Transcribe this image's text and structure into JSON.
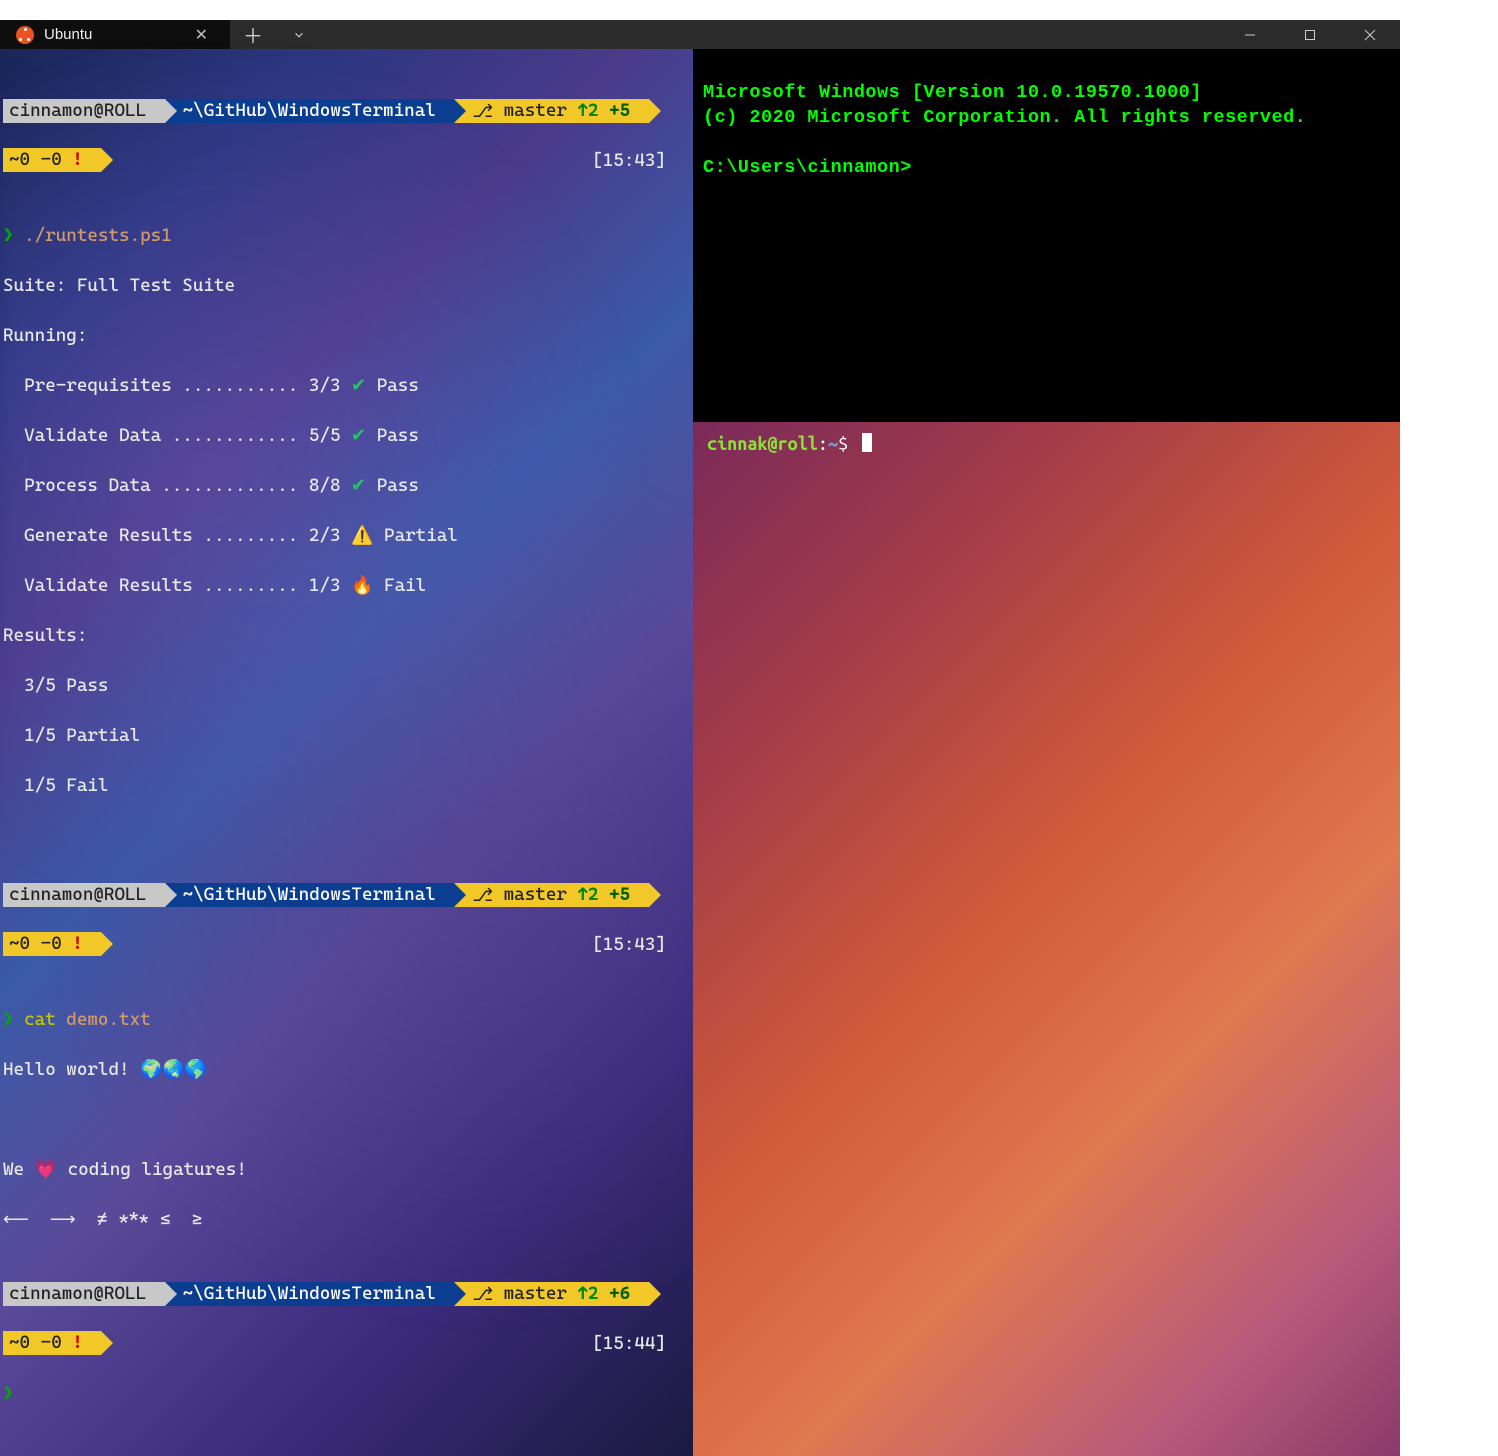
{
  "titlebar": {
    "tab_name": "Ubuntu",
    "close_symbol": "✕",
    "add_symbol": "＋"
  },
  "left": {
    "prompt1": {
      "host": "cinnamon@ROLL ",
      "path": "~\\GitHub\\WindowsTerminal ",
      "branch_icon": "⎇",
      "branch": " master ",
      "ahead": "↑2 ",
      "staged": "+5 ",
      "status": "~0 -0 ",
      "bang": "!",
      "time": "[15:43]"
    },
    "cmd1_caret": "❯ ",
    "cmd1": "./runtests.ps1",
    "suite_label": "Suite: Full Test Suite",
    "running_label": "Running:",
    "tests": [
      {
        "name": "  Pre-requisites ........... 3/3 ",
        "icon": "✔",
        "status": " Pass"
      },
      {
        "name": "  Validate Data ............ 5/5 ",
        "icon": "✔",
        "status": " Pass"
      },
      {
        "name": "  Process Data ............. 8/8 ",
        "icon": "✔",
        "status": " Pass"
      },
      {
        "name": "  Generate Results ......... 2/3 ",
        "icon": "⚠️",
        "status": " Partial"
      },
      {
        "name": "  Validate Results ......... 1/3 ",
        "icon": "🔥",
        "status": " Fail"
      }
    ],
    "results_label": "Results:",
    "results": [
      "  3/5 Pass",
      "  1/5 Partial",
      "  1/5 Fail"
    ],
    "prompt2": {
      "host": "cinnamon@ROLL ",
      "path": "~\\GitHub\\WindowsTerminal ",
      "branch_icon": "⎇",
      "branch": " master ",
      "ahead": "↑2 ",
      "staged": "+5 ",
      "status": "~0 -0 ",
      "bang": "!",
      "time": "[15:43]"
    },
    "cmd2_caret": "❯ ",
    "cmd2_cmd": "cat ",
    "cmd2_arg": "demo.txt",
    "hello": "Hello world! 🌍🌏🌎",
    "ligatures_line": "We 💗 coding ligatures!",
    "symbols_line": "⟵  ⟶  ≠ *** ≤  ≥",
    "prompt3": {
      "host": "cinnamon@ROLL ",
      "path": "~\\GitHub\\WindowsTerminal ",
      "branch_icon": "⎇",
      "branch": " master ",
      "ahead": "↑2 ",
      "staged": "+6 ",
      "status": "~0 -0 ",
      "bang": "!",
      "time": "[15:44]"
    },
    "cmd3_caret": "❯"
  },
  "right_top": {
    "line1": "Microsoft Windows [Version 10.0.19570.1000]",
    "line2": "(c) 2020 Microsoft Corporation. All rights reserved.",
    "prompt": "C:\\Users\\cinnamon>"
  },
  "right_bottom": {
    "user": "cinnak@roll",
    "colon": ":",
    "path": "~",
    "dollar": "$ "
  }
}
